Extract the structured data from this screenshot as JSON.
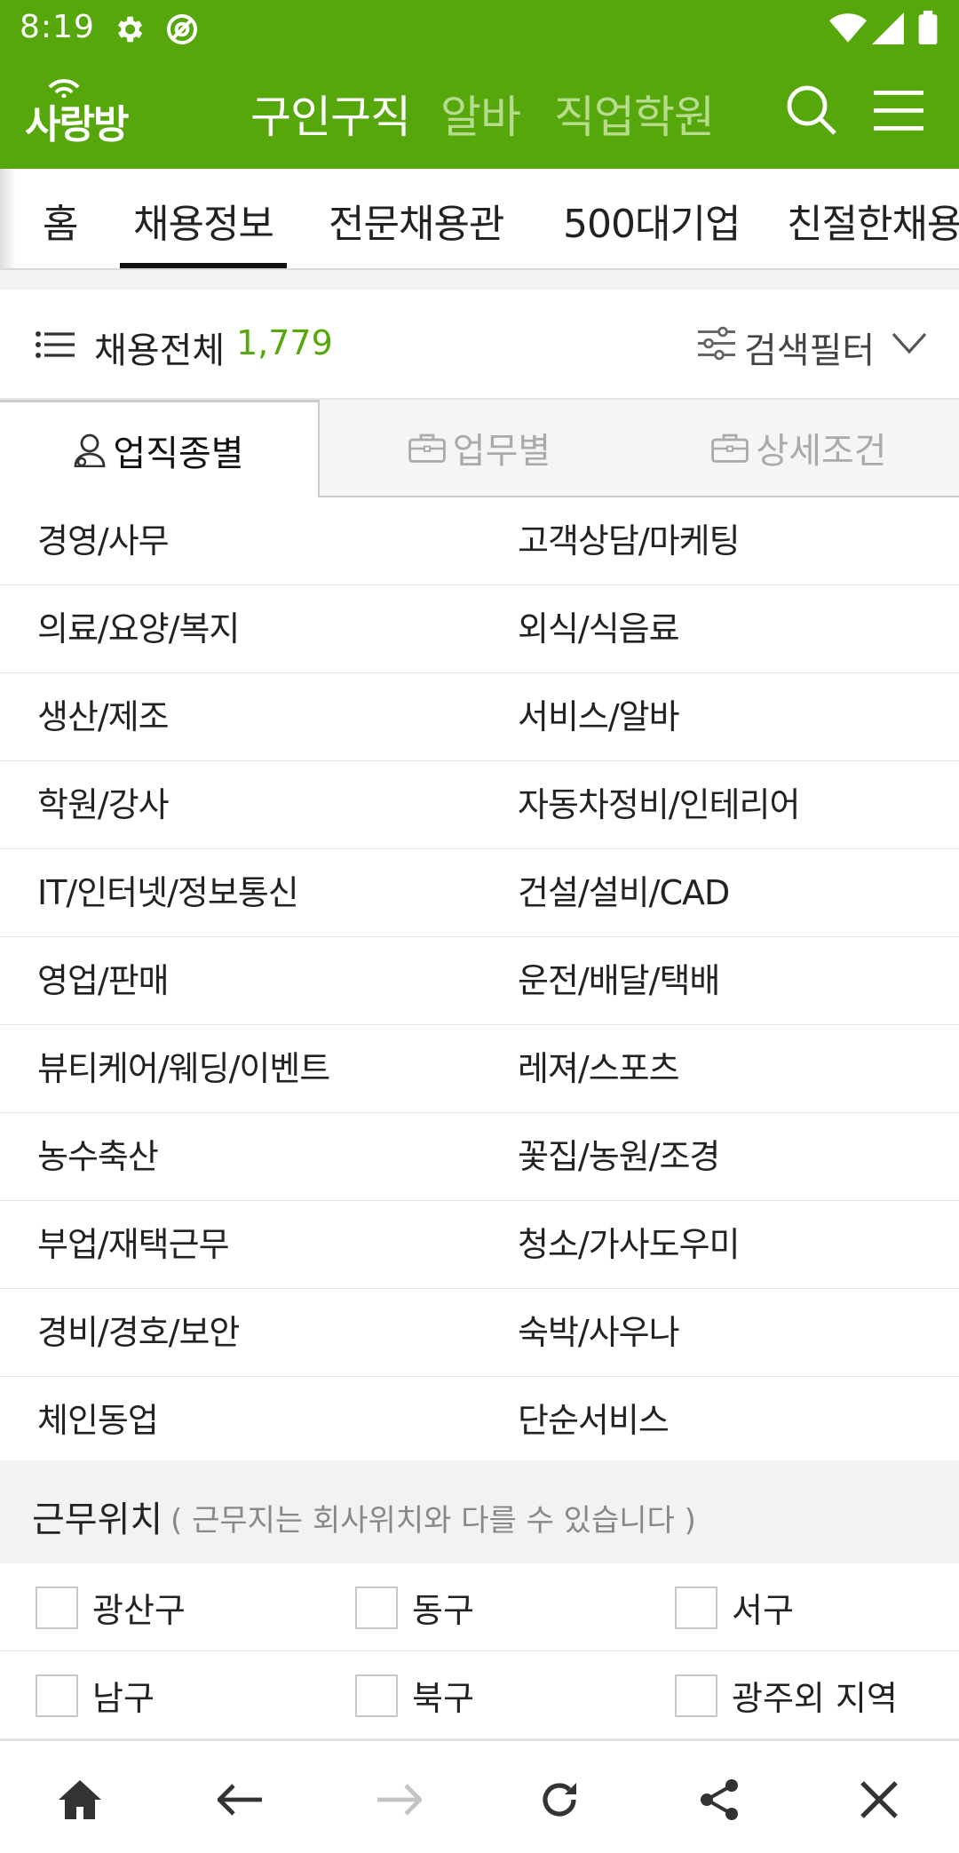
{
  "status_bar": {
    "time": "8:19",
    "icons": [
      "gear-icon",
      "at-icon",
      "wifi-icon",
      "signal-icon",
      "battery-icon"
    ]
  },
  "header": {
    "logo_text": "사랑방",
    "nav": [
      "구인구직",
      "알바",
      "직업학원"
    ],
    "active_nav_index": 0,
    "icons": [
      "search-icon",
      "menu-icon"
    ],
    "brand_color": "#56a70c"
  },
  "subtabs": {
    "items": [
      "홈",
      "채용정보",
      "전문채용관",
      "500대기업",
      "친절한채용"
    ],
    "active_index": 1
  },
  "count_bar": {
    "label": "채용전체",
    "count": "1,779",
    "filter_label": "검색필터"
  },
  "category_tabs": {
    "items": [
      "업직종별",
      "업무별",
      "상세조건"
    ],
    "active_index": 0
  },
  "categories": {
    "rows": [
      [
        "경영/사무",
        "고객상담/마케팅"
      ],
      [
        "의료/요양/복지",
        "외식/식음료"
      ],
      [
        "생산/제조",
        "서비스/알바"
      ],
      [
        "학원/강사",
        "자동차정비/인테리어"
      ],
      [
        "IT/인터넷/정보통신",
        "건설/설비/CAD"
      ],
      [
        "영업/판매",
        "운전/배달/택배"
      ],
      [
        "뷰티케어/웨딩/이벤트",
        "레져/스포츠"
      ],
      [
        "농수축산",
        "꽃집/농원/조경"
      ],
      [
        "부업/재택근무",
        "청소/가사도우미"
      ],
      [
        "경비/경호/보안",
        "숙박/사우나"
      ],
      [
        "체인동업",
        "단순서비스"
      ]
    ]
  },
  "location": {
    "title": "근무위치",
    "note": "( 근무지는 회사위치와 다를 수 있습니다 )",
    "rows": [
      [
        "광산구",
        "동구",
        "서구"
      ],
      [
        "남구",
        "북구",
        "광주외 지역"
      ]
    ]
  },
  "bottom_nav": {
    "icons": [
      "home-icon",
      "back-arrow-icon",
      "forward-arrow-icon",
      "refresh-icon",
      "share-icon",
      "close-icon"
    ],
    "disabled_index": 2
  }
}
